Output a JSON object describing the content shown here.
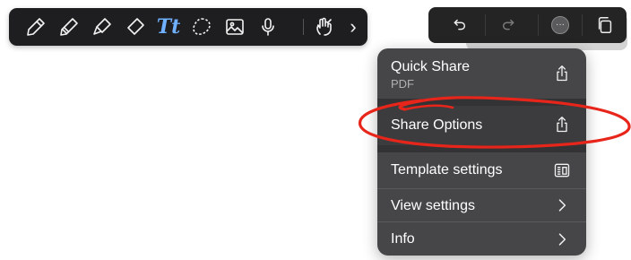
{
  "toolbar": {
    "tools": [
      {
        "icon": "pen-icon"
      },
      {
        "icon": "pencil-icon"
      },
      {
        "icon": "highlighter-icon"
      },
      {
        "icon": "eraser-icon"
      },
      {
        "icon": "text-tool-icon",
        "label": "Tt"
      },
      {
        "icon": "lasso-icon"
      },
      {
        "icon": "image-icon"
      },
      {
        "icon": "microphone-icon"
      },
      {
        "icon": "hand-gesture-icon"
      },
      {
        "icon": "chevron-right-icon",
        "label": "›"
      }
    ],
    "accent_color": "#6fb0ff"
  },
  "actions": {
    "undo_icon": "undo-icon",
    "redo_icon": "redo-icon",
    "more_icon": "more-icon",
    "more_label": "···",
    "pages_icon": "pages-icon"
  },
  "menu": {
    "quick_share": {
      "label": "Quick Share",
      "sub": "PDF",
      "icon": "share-icon"
    },
    "share_options": {
      "label": "Share Options",
      "icon": "share-icon"
    },
    "template_settings": {
      "label": "Template settings",
      "icon": "template-icon"
    },
    "view_settings": {
      "label": "View settings",
      "icon": "chevron-right-icon"
    },
    "info": {
      "label": "Info",
      "icon": "chevron-right-icon"
    }
  },
  "annotation": {
    "color": "#e8251a",
    "type": "red-ellipse-around-share-options"
  }
}
